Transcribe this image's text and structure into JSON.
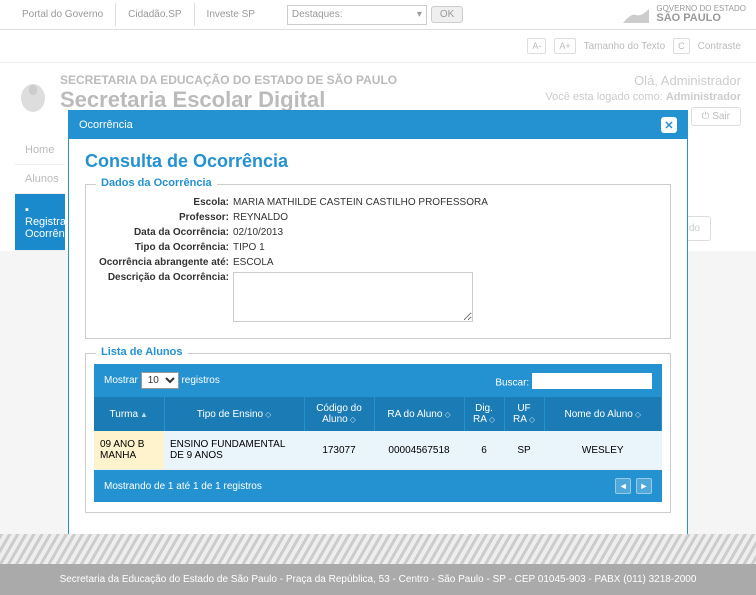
{
  "topbar": {
    "links": [
      "Portal do Governo",
      "Cidadão.SP",
      "Investe SP"
    ],
    "destaques_label": "Destaques:",
    "ok": "OK",
    "gov_small": "GOVERNO DO ESTADO",
    "gov_big": "SÃO PAULO"
  },
  "subheader": {
    "a_minus": "A-",
    "a_plus": "A+",
    "tamanho": "Tamanho do Texto",
    "c": "C",
    "contraste": "Contraste"
  },
  "header": {
    "line1": "SECRETARIA DA EDUCAÇÃO DO ESTADO DE SÃO PAULO",
    "line2": "Secretaria Escolar Digital",
    "greeting": "Olá, Administrador",
    "logged_as": "Você esta logado como: ",
    "role": "Administrador",
    "sair": "Sair"
  },
  "nav": {
    "home": "Home",
    "alunos": "Alunos",
    "registrar": "Registrar Ocorrência"
  },
  "search_hint": "Nome do",
  "modal": {
    "header": "Ocorrência",
    "title": "Consulta de Ocorrência",
    "fieldset1_legend": "Dados da Ocorrência",
    "fields": {
      "escola_label": "Escola:",
      "escola_value": "MARIA MATHILDE CASTEIN CASTILHO PROFESSORA",
      "professor_label": "Professor:",
      "professor_value": "REYNALDO",
      "data_label": "Data da Ocorrência:",
      "data_value": "02/10/2013",
      "tipo_label": "Tipo da Ocorrência:",
      "tipo_value": "TIPO 1",
      "abrang_label": "Ocorrência abrangente até:",
      "abrang_value": "ESCOLA",
      "desc_label": "Descrição da Ocorrência:"
    },
    "fieldset2_legend": "Lista de Alunos",
    "dt": {
      "mostrar": "Mostrar",
      "registros": "registros",
      "page_size": "10",
      "buscar": "Buscar:",
      "cols": {
        "turma": "Turma",
        "tipo_ensino": "Tipo de Ensino",
        "codigo": "Código do Aluno",
        "ra": "RA do Aluno",
        "dig": "Dig. RA",
        "uf": "UF RA",
        "nome": "Nome do Aluno"
      },
      "row": {
        "turma": "09 ANO B MANHA",
        "tipo_ensino": "ENSINO FUNDAMENTAL DE 9 ANOS",
        "codigo": "173077",
        "ra": "00004567518",
        "dig": "6",
        "uf": "SP",
        "nome": "WESLEY"
      },
      "info": "Mostrando de 1 até 1 de 1 registros"
    }
  },
  "footer": "Secretaria da Educação do Estado de São Paulo - Praça da República, 53 - Centro - São Paulo - SP - CEP 01045-903 - PABX (011) 3218-2000"
}
